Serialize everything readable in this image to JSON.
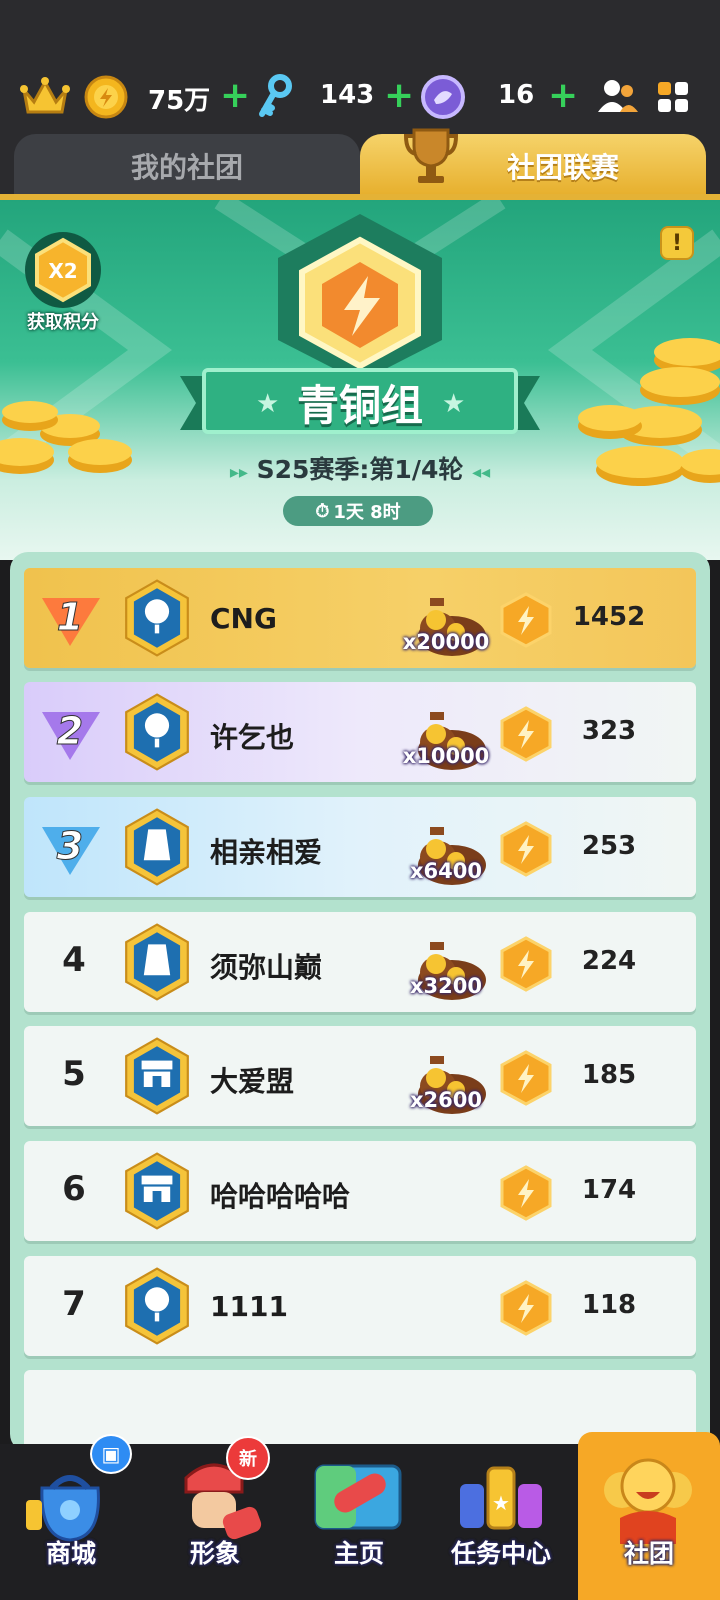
{
  "currency": {
    "coins": "75万",
    "keys": "143",
    "gems": "16"
  },
  "tabs": {
    "my_club": "我的社团",
    "league": "社团联赛"
  },
  "banner": {
    "bonus_multiplier": "X2",
    "bonus_label": "获取积分",
    "info_icon": "!",
    "group_name": "青铜组",
    "season": "S25赛季:第1/4轮",
    "timer": "1天 8时"
  },
  "ranking": [
    {
      "rank": "1",
      "name": "CNG",
      "reward": "x20000",
      "points": "1452"
    },
    {
      "rank": "2",
      "name": "许乞也",
      "reward": "x10000",
      "points": "323"
    },
    {
      "rank": "3",
      "name": "相亲相爱",
      "reward": "x6400",
      "points": "253"
    },
    {
      "rank": "4",
      "name": "须弥山巅",
      "reward": "x3200",
      "points": "224"
    },
    {
      "rank": "5",
      "name": "大爱盟",
      "reward": "x2600",
      "points": "185"
    },
    {
      "rank": "6",
      "name": "哈哈哈哈哈",
      "reward": "",
      "points": "174"
    },
    {
      "rank": "7",
      "name": "1111",
      "reward": "",
      "points": "118"
    }
  ],
  "nav": {
    "shop": "商城",
    "avatar": "形象",
    "home": "主页",
    "tasks": "任务中心",
    "club": "社团",
    "new_badge": "新"
  },
  "colors": {
    "accent_gold": "#f6a826",
    "banner_green": "#23a57c",
    "plus_green": "#36d05a"
  }
}
